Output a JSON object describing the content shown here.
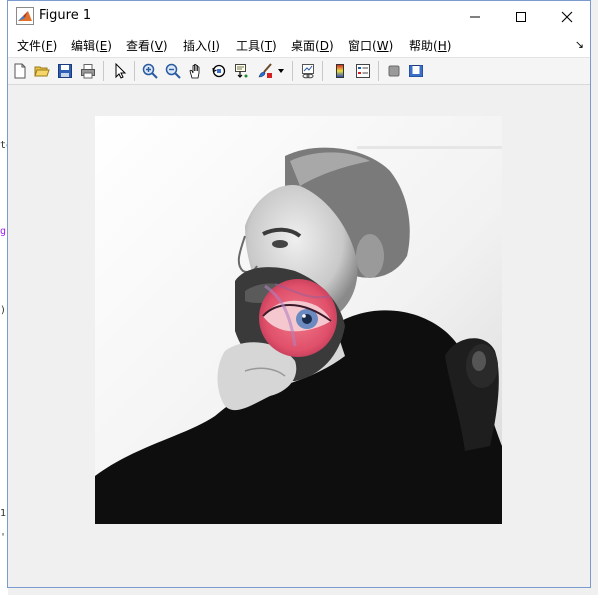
{
  "window": {
    "title": "Figure 1"
  },
  "background_fragments": [
    "to",
    "g'",
    ")",
    "1",
    "'"
  ],
  "menu": [
    {
      "label": "文件",
      "key": "F"
    },
    {
      "label": "编辑",
      "key": "E"
    },
    {
      "label": "查看",
      "key": "V"
    },
    {
      "label": "插入",
      "key": "I"
    },
    {
      "label": "工具",
      "key": "T"
    },
    {
      "label": "桌面",
      "key": "D"
    },
    {
      "label": "窗口",
      "key": "W"
    },
    {
      "label": "帮助",
      "key": "H"
    }
  ],
  "toolbar_icons": [
    "new-figure-icon",
    "open-folder-icon",
    "save-icon",
    "print-icon",
    "pointer-arrow-icon",
    "zoom-in-icon",
    "zoom-out-icon",
    "pan-hand-icon",
    "rotate-3d-icon",
    "data-cursor-icon",
    "brush-icon",
    "dropdown-arrow-icon",
    "link-plot-icon",
    "colorbar-icon",
    "legend-icon",
    "hide-plot-tools-icon",
    "show-plot-tools-icon"
  ],
  "colors": {
    "overlay_circle": "#e0506a",
    "window_border": "#7a9bd0",
    "brush_red": "#d42020"
  }
}
